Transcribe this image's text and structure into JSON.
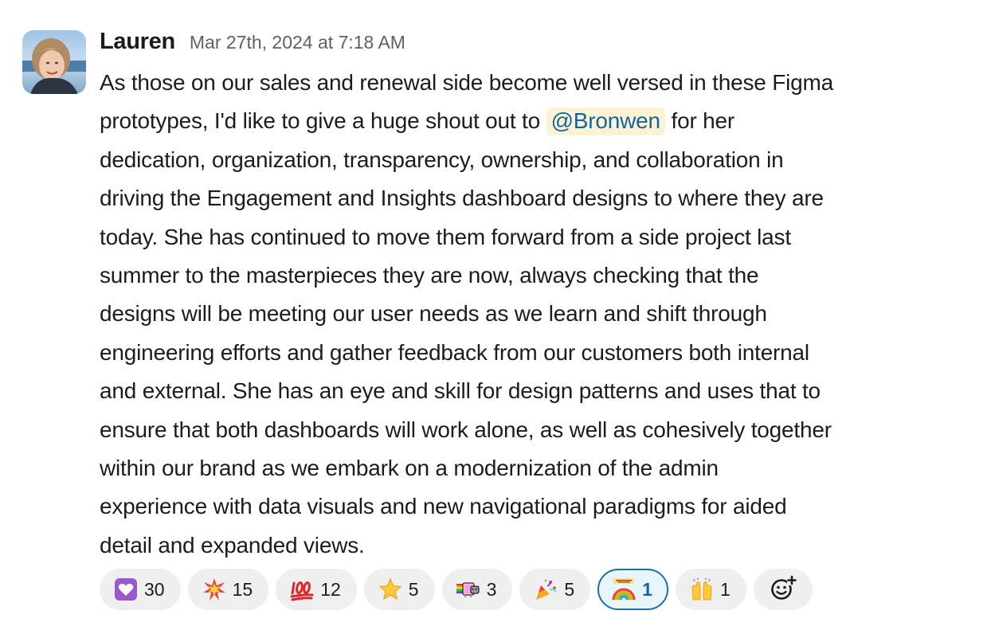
{
  "message": {
    "author": "Lauren",
    "timestamp": "Mar 27th, 2024 at 7:18 AM",
    "lines": [
      {
        "text": "As those on our sales and renewal side become well versed in these Figma"
      },
      {
        "before": "prototypes, I'd like to give a huge shout out to ",
        "mention": "@Bronwen",
        "after": " for her"
      },
      {
        "text": "dedication, organization, transparency, ownership, and collaboration in"
      },
      {
        "text": "driving the Engagement and Insights dashboard designs to where they are"
      },
      {
        "text": "today. She has continued to move them forward from a side project last"
      },
      {
        "text": "summer to the masterpieces they are now, always checking that the"
      },
      {
        "text": "designs will be meeting our user needs as we learn and shift through"
      },
      {
        "text": "engineering efforts and gather feedback from our customers both internal"
      },
      {
        "text": "and external. She has an eye and skill for design patterns and uses that to"
      },
      {
        "text": "ensure that both dashboards will work alone, as well as cohesively together"
      },
      {
        "text": "within our brand as we embark on a modernization of the admin"
      },
      {
        "text": "experience with data visuals and new navigational paradigms for aided"
      },
      {
        "text": "detail and expanded views."
      }
    ]
  },
  "reactions": [
    {
      "icon": "purple-heart-emoji",
      "count": "30",
      "active": false
    },
    {
      "icon": "collision-emoji",
      "count": "15",
      "active": false
    },
    {
      "icon": "hundred-points-emoji",
      "count": "12",
      "active": false
    },
    {
      "icon": "star-emoji",
      "count": "5",
      "active": false
    },
    {
      "icon": "nyan-cat-emoji",
      "count": "3",
      "active": false
    },
    {
      "icon": "party-popper-emoji",
      "count": "5",
      "active": false
    },
    {
      "icon": "thank-you-rainbow-emoji",
      "count": "1",
      "active": true
    },
    {
      "icon": "raising-hands-emoji",
      "count": "1",
      "active": false
    }
  ],
  "colors": {
    "mention_bg": "#fdf3d3",
    "mention_text": "#1264a3",
    "reaction_bg": "#efefef",
    "active_reaction_border": "#1d6fa5",
    "active_reaction_bg": "#e8f5fa",
    "timestamp": "#616061"
  }
}
